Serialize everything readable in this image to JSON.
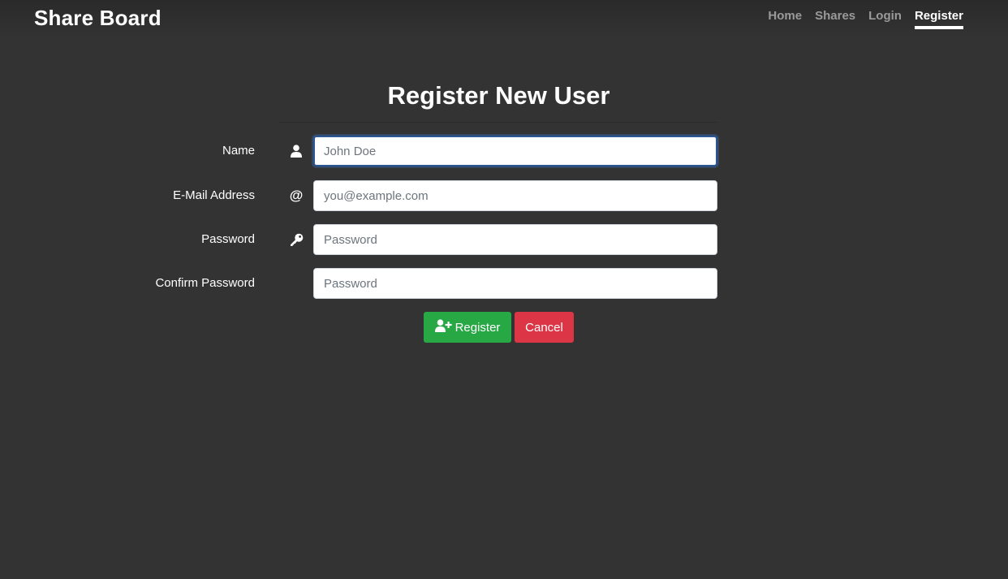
{
  "header": {
    "brand": "Share Board",
    "nav": [
      {
        "label": "Home",
        "active": false
      },
      {
        "label": "Shares",
        "active": false
      },
      {
        "label": "Login",
        "active": false
      },
      {
        "label": "Register",
        "active": true
      }
    ]
  },
  "page": {
    "title": "Register New User"
  },
  "form": {
    "name": {
      "label": "Name",
      "placeholder": "John Doe",
      "value": "",
      "icon": "user-icon"
    },
    "email": {
      "label": "E-Mail Address",
      "placeholder": "you@example.com",
      "value": "",
      "icon": "at-icon",
      "glyph": "@"
    },
    "password": {
      "label": "Password",
      "placeholder": "Password",
      "value": "",
      "icon": "key-icon"
    },
    "confirm_password": {
      "label": "Confirm Password",
      "placeholder": "Password",
      "value": ""
    },
    "register_label": "Register",
    "cancel_label": "Cancel"
  },
  "colors": {
    "background": "#333333",
    "register": "#28a745",
    "cancel": "#dc3545",
    "focus": "#2b5797",
    "nav_inactive": "#9a9a9a"
  }
}
